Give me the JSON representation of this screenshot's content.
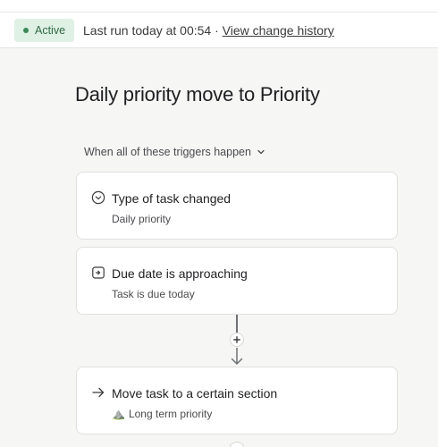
{
  "header": {
    "status": "Active",
    "last_run": "Last run today at 00:54 · ",
    "history_link": "View change history"
  },
  "rule": {
    "title": "Daily priority move to Priority",
    "trigger_mode": "When all of these triggers happen"
  },
  "triggers": [
    {
      "title": "Type of task changed",
      "subtitle": "Daily priority",
      "icon": "chevron-circle-icon"
    },
    {
      "title": "Due date is approaching",
      "subtitle": "Task is due today",
      "icon": "calendar-clock-icon"
    }
  ],
  "action": {
    "title": "Move task to a certain section",
    "section_emoji": "⛰️",
    "section_name": "Long term priority",
    "icon": "arrow-right-icon"
  },
  "colors": {
    "active_bg": "#dff0e4",
    "active_text": "#2e6b45",
    "connector": "#6e7175"
  }
}
